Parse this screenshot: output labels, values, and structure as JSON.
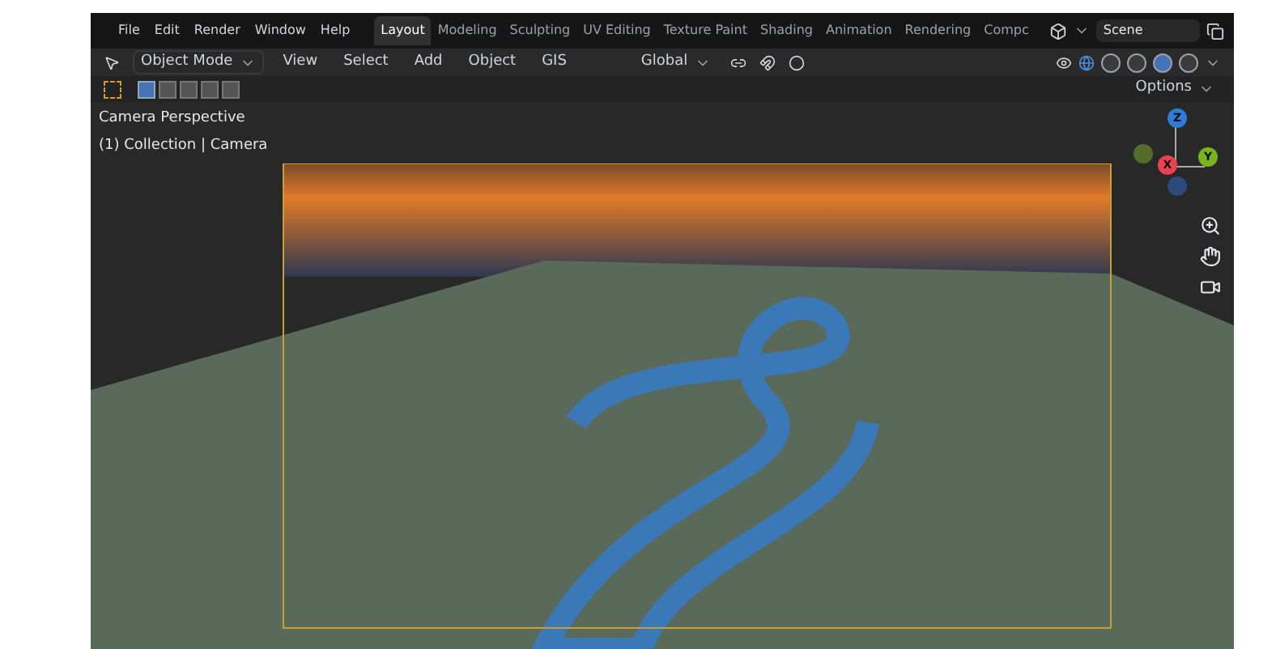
{
  "menu": [
    "File",
    "Edit",
    "Render",
    "Window",
    "Help"
  ],
  "workspaces": [
    {
      "label": "Layout",
      "selected": true
    },
    {
      "label": "Modeling",
      "selected": false
    },
    {
      "label": "Sculpting",
      "selected": false
    },
    {
      "label": "UV Editing",
      "selected": false
    },
    {
      "label": "Texture Paint",
      "selected": false
    },
    {
      "label": "Shading",
      "selected": false
    },
    {
      "label": "Animation",
      "selected": false
    },
    {
      "label": "Rendering",
      "selected": false
    },
    {
      "label": "Compc",
      "selected": false
    }
  ],
  "scene": "Scene",
  "header": {
    "mode": "Object Mode",
    "menus": [
      "View",
      "Select",
      "Add",
      "Object",
      "GIS"
    ],
    "orientation": "Global",
    "shading": [
      {
        "selected": false
      },
      {
        "selected": false
      },
      {
        "selected": true
      },
      {
        "selected": false
      }
    ]
  },
  "select_modes": [
    {
      "selected": true
    },
    {
      "selected": false
    },
    {
      "selected": false
    },
    {
      "selected": false
    },
    {
      "selected": false
    }
  ],
  "options": "Options",
  "viewport": {
    "title": "Camera Perspective",
    "subtitle": "(1) Collection | Camera"
  },
  "gizmo": [
    {
      "label": "Z",
      "color": "#2f7bd6"
    },
    {
      "label": "X",
      "color": "#e8414f"
    },
    {
      "label": "Y",
      "color": "#7bb21f"
    }
  ]
}
